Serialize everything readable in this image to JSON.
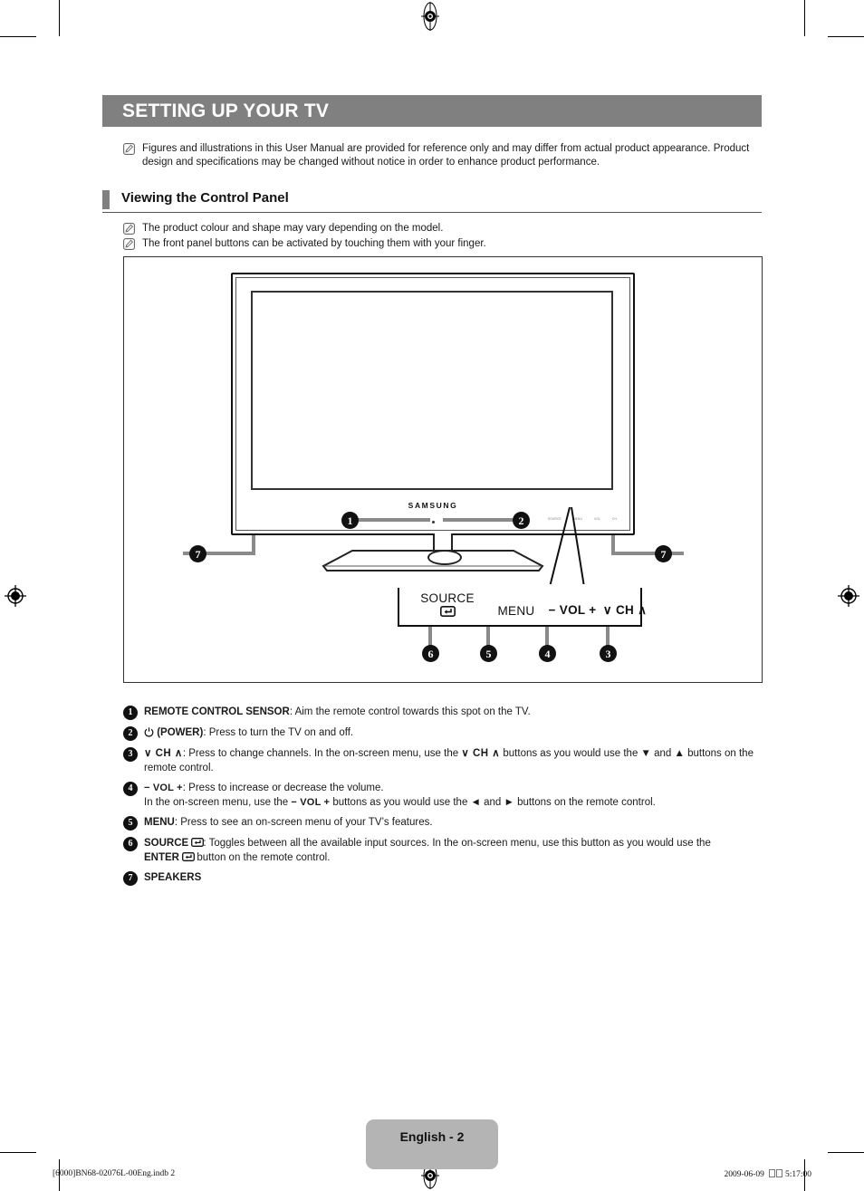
{
  "chapter": {
    "title": "SETTING UP YOUR TV"
  },
  "intro_notes": [
    {
      "icon": "note-icon",
      "text": "Figures and illustrations in this User Manual are provided for reference only and may differ from actual product appearance. Product design and specifications may be changed without notice in order to enhance product performance."
    }
  ],
  "section": {
    "title": "Viewing the Control Panel",
    "notes": [
      {
        "icon": "note-icon",
        "text": "The product colour and shape may vary depending on the model."
      },
      {
        "icon": "note-icon",
        "text": "The front panel buttons can be activated by touching them with your finger."
      }
    ]
  },
  "illustration": {
    "brand": "SAMSUNG",
    "mini_panel": [
      "SOURCE",
      "MENU",
      "VOL",
      "CH"
    ],
    "callouts": {
      "source_label": "SOURCE",
      "source_icon": "enter-icon",
      "menu_label": "MENU",
      "vol_label": "− VOL +",
      "ch_label": "∨ CH ∧"
    },
    "markers": {
      "sensor": "1",
      "power": "2",
      "channel": "3",
      "volume": "4",
      "menu": "5",
      "source": "6",
      "speaker_left": "7",
      "speaker_right": "7"
    }
  },
  "legend": [
    {
      "num": "1",
      "name": "REMOTE CONTROL SENSOR",
      "term": "REMOTE CONTROL SENSOR",
      "desc": ": Aim the remote control towards this spot on the TV."
    },
    {
      "num": "2",
      "name": "POWER",
      "term": "(POWER)",
      "desc": ": Press to turn the TV on and off."
    },
    {
      "num": "3",
      "name": "CHANNEL",
      "term": "∨ CH ∧",
      "desc": ": Press to change channels. In the on-screen menu, use the",
      "desc2": "buttons as you would use the ▼ and ▲ buttons on the remote control."
    },
    {
      "num": "4",
      "name": "VOLUME",
      "term": "− VOL +",
      "desc": ": Press to increase or decrease the volume.",
      "desc2a": "In the on-screen menu, use the",
      "desc2b": "buttons as you would use the ◄ and ► buttons on the remote control."
    },
    {
      "num": "5",
      "name": "MENU",
      "term": "MENU",
      "desc": ": Press to see an on-screen menu of your TV’s features."
    },
    {
      "num": "6",
      "name": "SOURCE",
      "term": "SOURCE",
      "desc": ": Toggles between all the available input sources. In the on-screen menu, use this button as you would use the",
      "enter_term": "ENTER",
      "desc2": "button on the remote control."
    },
    {
      "num": "7",
      "name": "SPEAKERS",
      "term": "SPEAKERS",
      "desc": ""
    }
  ],
  "footer": {
    "page_label": "English - 2",
    "file_ref": "[6000]BN68-02076L-00Eng.indb   2",
    "date": "2009-06-09",
    "time": "5:17:00"
  },
  "colors": {
    "chapter_bar": "#808080",
    "section_tab": "#808080",
    "badge": "#111111",
    "page_badge": "#b4b4b4",
    "leader": "#8a8a8a"
  }
}
